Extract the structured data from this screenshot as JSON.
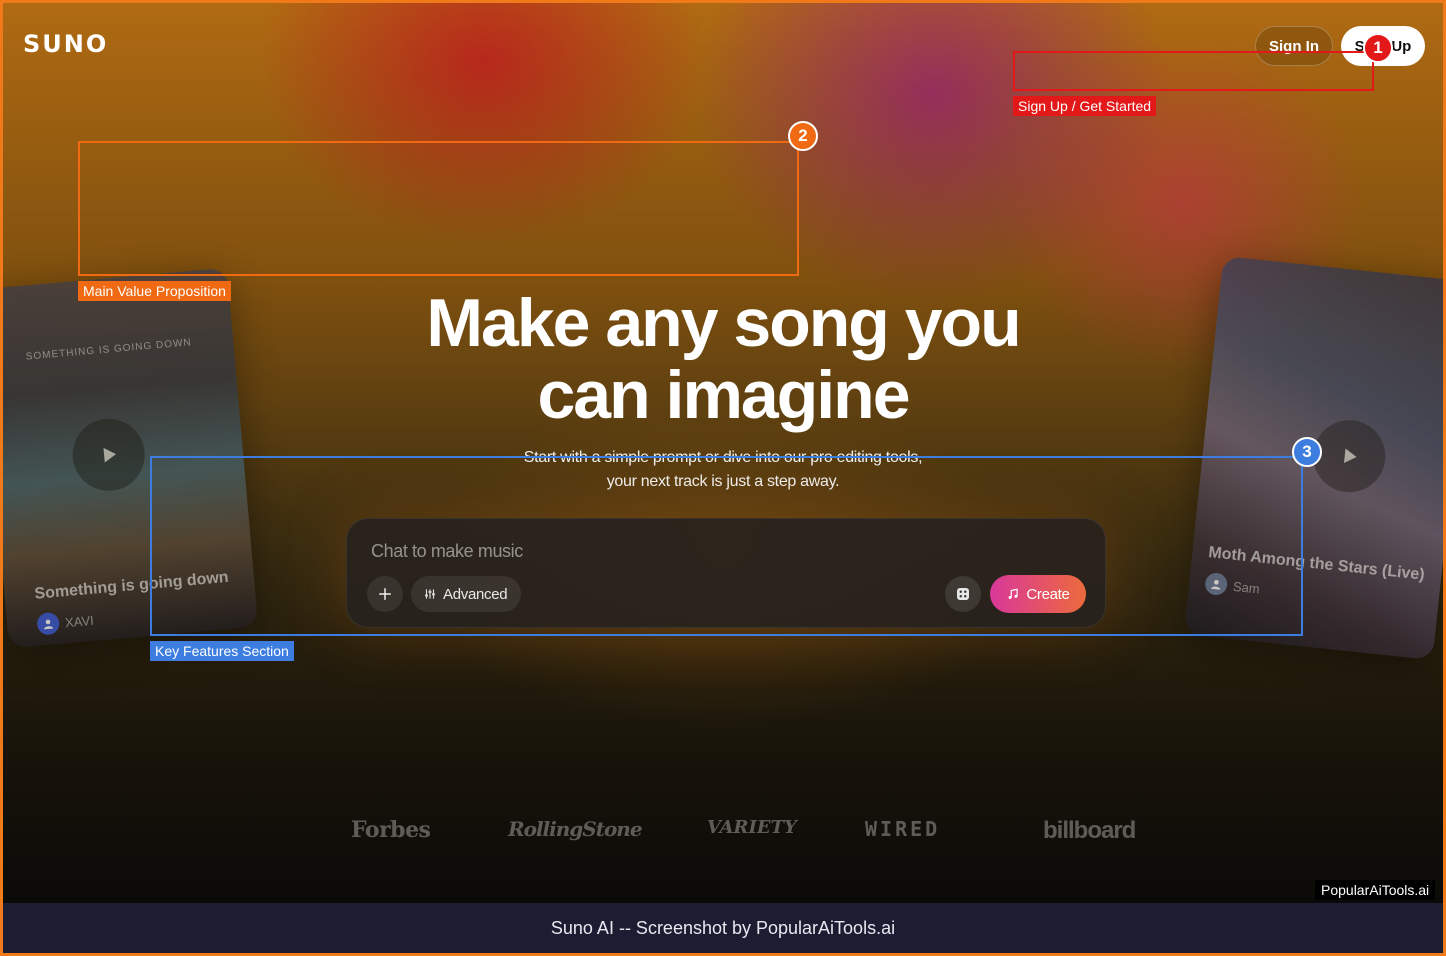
{
  "header": {
    "logo": "SUNO",
    "signin_label": "Sign In",
    "signup_label": "Sign Up"
  },
  "hero": {
    "headline": "Make any song you can imagine",
    "subline": "Start with a simple prompt or dive into our pro editing tools, your next track is just a step away."
  },
  "cards": {
    "left": {
      "tag": "SOMETHING IS GOING DOWN",
      "title": "Something is going down",
      "artist": "XAVI"
    },
    "right": {
      "title": "Moth Among the Stars (Live)",
      "artist": "Sam"
    }
  },
  "composer": {
    "placeholder": "Chat to make music",
    "advanced_label": "Advanced",
    "create_label": "Create"
  },
  "press": [
    "Forbes",
    "RollingStone",
    "VARIETY",
    "WIRED",
    "billboard"
  ],
  "annotations": {
    "box1_label": "Sign Up / Get Started",
    "box2_label": "Main Value Proposition",
    "box3_label": "Key Features Section",
    "badges": [
      "1",
      "2",
      "3"
    ],
    "colors": {
      "red": "#e31818",
      "orange": "#ef6a12",
      "blue": "#3d7de0"
    }
  },
  "watermark": "PopularAiTools.ai",
  "footer": "Suno AI -- Screenshot by PopularAiTools.ai",
  "colors": {
    "create_gradient_start": "#d9389a",
    "create_gradient_end": "#ec6a3c",
    "frame": "#f07a1a"
  }
}
